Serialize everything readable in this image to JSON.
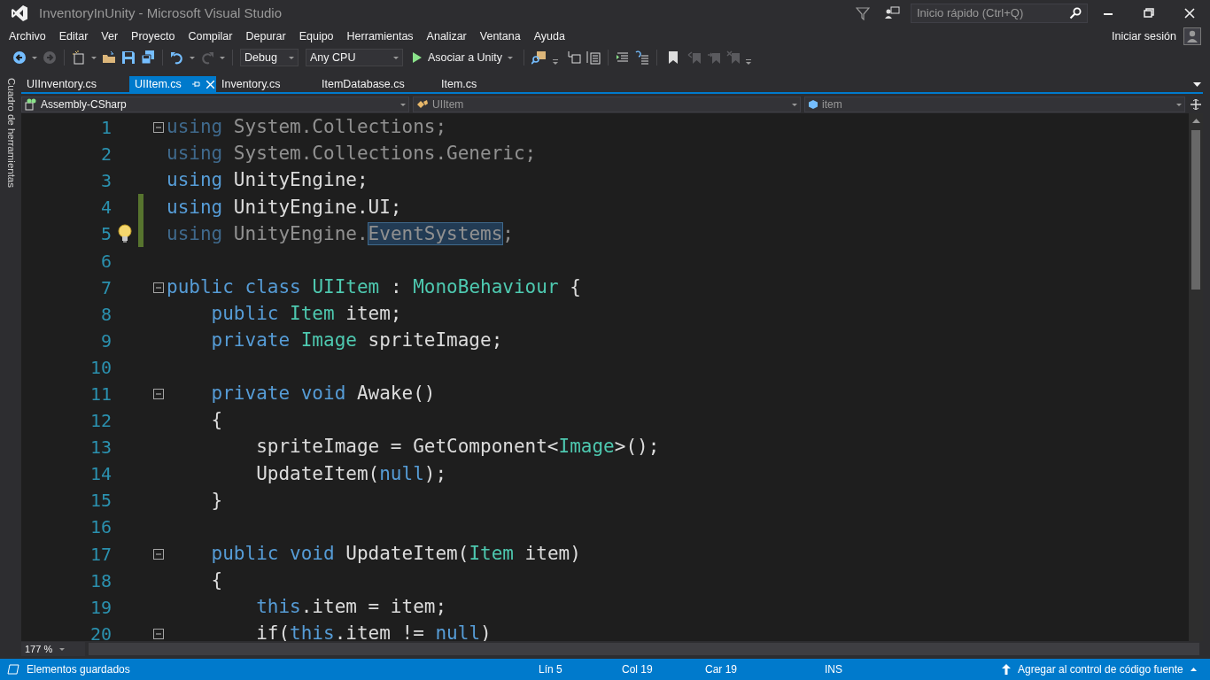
{
  "window": {
    "title": "InventoryInUnity - Microsoft Visual Studio",
    "quick_launch": {
      "placeholder": "Inicio rápido (Ctrl+Q)"
    },
    "sign_in": "Iniciar sesión"
  },
  "menu": [
    "Archivo",
    "Editar",
    "Ver",
    "Proyecto",
    "Compilar",
    "Depurar",
    "Equipo",
    "Herramientas",
    "Analizar",
    "Ventana",
    "Ayuda"
  ],
  "toolbar": {
    "configuration": "Debug",
    "platform": "Any CPU",
    "run": "Asociar a Unity"
  },
  "side_panel": {
    "label": "Cuadro de herramientas"
  },
  "tabs": [
    {
      "label": "UIInventory.cs",
      "selected": false
    },
    {
      "label": "UIItem.cs",
      "selected": true
    },
    {
      "label": "Inventory.cs",
      "selected": false
    },
    {
      "label": "ItemDatabase.cs",
      "selected": false
    },
    {
      "label": "Item.cs",
      "selected": false
    }
  ],
  "nav_bar": {
    "project": "Assembly-CSharp",
    "type": "UIItem",
    "member": "item"
  },
  "editor": {
    "lines": [
      {
        "number": "1",
        "foldable": true,
        "changed": false,
        "unused": true,
        "lightbulb": false,
        "tokens": [
          {
            "text": "using",
            "kind": "keyword"
          },
          {
            "text": " System.Collections;",
            "kind": "plain"
          }
        ]
      },
      {
        "number": "2",
        "foldable": false,
        "changed": false,
        "unused": true,
        "lightbulb": false,
        "tokens": [
          {
            "text": "using",
            "kind": "keyword"
          },
          {
            "text": " System.Collections.Generic;",
            "kind": "plain"
          }
        ]
      },
      {
        "number": "3",
        "foldable": false,
        "changed": false,
        "unused": false,
        "lightbulb": false,
        "tokens": [
          {
            "text": "using",
            "kind": "keyword"
          },
          {
            "text": " UnityEngine;",
            "kind": "plain"
          }
        ]
      },
      {
        "number": "4",
        "foldable": false,
        "changed": true,
        "unused": false,
        "lightbulb": false,
        "tokens": [
          {
            "text": "using",
            "kind": "keyword"
          },
          {
            "text": " UnityEngine.UI;",
            "kind": "plain"
          }
        ]
      },
      {
        "number": "5",
        "foldable": false,
        "changed": true,
        "unused": true,
        "lightbulb": true,
        "tokens": [
          {
            "text": "using",
            "kind": "keyword"
          },
          {
            "text": " UnityEngine.",
            "kind": "plain"
          },
          {
            "text": "EventSystems",
            "kind": "plain",
            "selected": true
          },
          {
            "text": ";",
            "kind": "plain"
          }
        ]
      },
      {
        "number": "6",
        "foldable": false,
        "changed": false,
        "unused": false,
        "lightbulb": false
      },
      {
        "number": "7",
        "foldable": true,
        "changed": false,
        "unused": false,
        "lightbulb": false,
        "tokens": [
          {
            "text": "public class ",
            "kind": "keyword"
          },
          {
            "text": "UIItem",
            "kind": "type"
          },
          {
            "text": " : ",
            "kind": "plain"
          },
          {
            "text": "MonoBehaviour",
            "kind": "type"
          },
          {
            "text": " {",
            "kind": "plain"
          }
        ]
      },
      {
        "number": "8",
        "foldable": false,
        "changed": false,
        "unused": false,
        "lightbulb": false,
        "tokens": [
          {
            "text": "    public ",
            "kind": "keyword"
          },
          {
            "text": "Item",
            "kind": "type"
          },
          {
            "text": " item;",
            "kind": "plain"
          }
        ]
      },
      {
        "number": "9",
        "foldable": false,
        "changed": false,
        "unused": false,
        "lightbulb": false,
        "tokens": [
          {
            "text": "    private ",
            "kind": "keyword"
          },
          {
            "text": "Image",
            "kind": "type"
          },
          {
            "text": " spriteImage;",
            "kind": "plain"
          }
        ]
      },
      {
        "number": "10",
        "foldable": false,
        "changed": false,
        "unused": false,
        "lightbulb": false
      },
      {
        "number": "11",
        "foldable": true,
        "changed": false,
        "unused": false,
        "lightbulb": false,
        "tokens": [
          {
            "text": "    private void ",
            "kind": "keyword"
          },
          {
            "text": "Awake()",
            "kind": "plain"
          }
        ]
      },
      {
        "number": "12",
        "foldable": false,
        "changed": false,
        "unused": false,
        "lightbulb": false,
        "tokens": [
          {
            "text": "    {",
            "kind": "plain"
          }
        ]
      },
      {
        "number": "13",
        "foldable": false,
        "changed": false,
        "unused": false,
        "lightbulb": false,
        "tokens": [
          {
            "text": "        spriteImage = GetComponent<",
            "kind": "plain"
          },
          {
            "text": "Image",
            "kind": "type"
          },
          {
            "text": ">();",
            "kind": "plain"
          }
        ]
      },
      {
        "number": "14",
        "foldable": false,
        "changed": false,
        "unused": false,
        "lightbulb": false,
        "tokens": [
          {
            "text": "        UpdateItem(",
            "kind": "plain"
          },
          {
            "text": "null",
            "kind": "keyword"
          },
          {
            "text": ");",
            "kind": "plain"
          }
        ]
      },
      {
        "number": "15",
        "foldable": false,
        "changed": false,
        "unused": false,
        "lightbulb": false,
        "tokens": [
          {
            "text": "    }",
            "kind": "plain"
          }
        ]
      },
      {
        "number": "16",
        "foldable": false,
        "changed": false,
        "unused": false,
        "lightbulb": false
      },
      {
        "number": "17",
        "foldable": true,
        "changed": false,
        "unused": false,
        "lightbulb": false,
        "tokens": [
          {
            "text": "    public void ",
            "kind": "keyword"
          },
          {
            "text": "UpdateItem(",
            "kind": "plain"
          },
          {
            "text": "Item",
            "kind": "type"
          },
          {
            "text": " item)",
            "kind": "plain"
          }
        ]
      },
      {
        "number": "18",
        "foldable": false,
        "changed": false,
        "unused": false,
        "lightbulb": false,
        "tokens": [
          {
            "text": "    {",
            "kind": "plain"
          }
        ]
      },
      {
        "number": "19",
        "foldable": false,
        "changed": false,
        "unused": false,
        "lightbulb": false,
        "tokens": [
          {
            "text": "        this",
            "kind": "keyword"
          },
          {
            "text": ".item = item;",
            "kind": "plain"
          }
        ]
      },
      {
        "number": "20",
        "foldable": true,
        "changed": false,
        "unused": false,
        "lightbulb": false,
        "tokens": [
          {
            "text": "        if(",
            "kind": "plain"
          },
          {
            "text": "this",
            "kind": "keyword"
          },
          {
            "text": ".item != ",
            "kind": "plain"
          },
          {
            "text": "null",
            "kind": "keyword"
          },
          {
            "text": ")",
            "kind": "plain"
          }
        ]
      }
    ],
    "zoom": "177 %"
  },
  "status_bar": {
    "message": "Elementos guardados",
    "line": "Lín 5",
    "column": "Col 19",
    "char": "Car 19",
    "mode": "INS",
    "source_control": "Agregar al control de código fuente"
  }
}
